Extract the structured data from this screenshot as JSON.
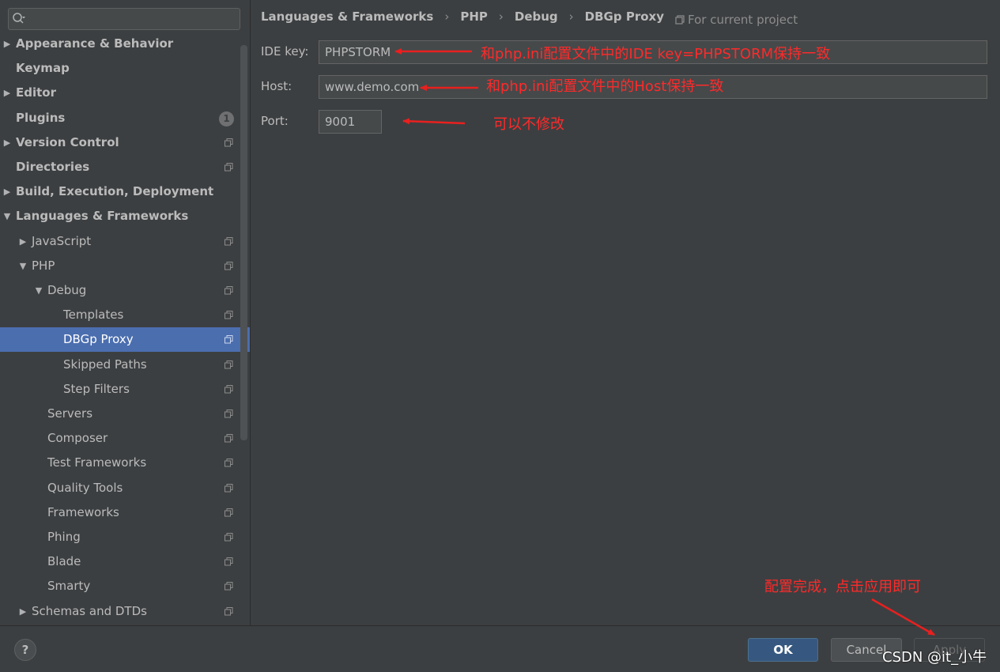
{
  "sidebar": {
    "search": {
      "placeholder": "",
      "value": ""
    },
    "items": [
      {
        "label": "Appearance & Behavior",
        "level": 0,
        "expander": "collapsed",
        "bold": true,
        "selected": false,
        "project": false,
        "badge": ""
      },
      {
        "label": "Keymap",
        "level": 0,
        "expander": "none",
        "bold": true,
        "selected": false,
        "project": false,
        "badge": ""
      },
      {
        "label": "Editor",
        "level": 0,
        "expander": "collapsed",
        "bold": true,
        "selected": false,
        "project": false,
        "badge": ""
      },
      {
        "label": "Plugins",
        "level": 0,
        "expander": "none",
        "bold": true,
        "selected": false,
        "project": false,
        "badge": "1"
      },
      {
        "label": "Version Control",
        "level": 0,
        "expander": "collapsed",
        "bold": true,
        "selected": false,
        "project": true,
        "badge": ""
      },
      {
        "label": "Directories",
        "level": 0,
        "expander": "none",
        "bold": true,
        "selected": false,
        "project": true,
        "badge": ""
      },
      {
        "label": "Build, Execution, Deployment",
        "level": 0,
        "expander": "collapsed",
        "bold": true,
        "selected": false,
        "project": false,
        "badge": ""
      },
      {
        "label": "Languages & Frameworks",
        "level": 0,
        "expander": "expanded",
        "bold": true,
        "selected": false,
        "project": false,
        "badge": ""
      },
      {
        "label": "JavaScript",
        "level": 1,
        "expander": "collapsed",
        "bold": false,
        "selected": false,
        "project": true,
        "badge": ""
      },
      {
        "label": "PHP",
        "level": 1,
        "expander": "expanded",
        "bold": false,
        "selected": false,
        "project": true,
        "badge": ""
      },
      {
        "label": "Debug",
        "level": 2,
        "expander": "expanded",
        "bold": false,
        "selected": false,
        "project": true,
        "badge": ""
      },
      {
        "label": "Templates",
        "level": 3,
        "expander": "none",
        "bold": false,
        "selected": false,
        "project": true,
        "badge": ""
      },
      {
        "label": "DBGp Proxy",
        "level": 3,
        "expander": "none",
        "bold": false,
        "selected": true,
        "project": true,
        "badge": ""
      },
      {
        "label": "Skipped Paths",
        "level": 3,
        "expander": "none",
        "bold": false,
        "selected": false,
        "project": true,
        "badge": ""
      },
      {
        "label": "Step Filters",
        "level": 3,
        "expander": "none",
        "bold": false,
        "selected": false,
        "project": true,
        "badge": ""
      },
      {
        "label": "Servers",
        "level": 2,
        "expander": "none",
        "bold": false,
        "selected": false,
        "project": true,
        "badge": ""
      },
      {
        "label": "Composer",
        "level": 2,
        "expander": "none",
        "bold": false,
        "selected": false,
        "project": true,
        "badge": ""
      },
      {
        "label": "Test Frameworks",
        "level": 2,
        "expander": "none",
        "bold": false,
        "selected": false,
        "project": true,
        "badge": ""
      },
      {
        "label": "Quality Tools",
        "level": 2,
        "expander": "none",
        "bold": false,
        "selected": false,
        "project": true,
        "badge": ""
      },
      {
        "label": "Frameworks",
        "level": 2,
        "expander": "none",
        "bold": false,
        "selected": false,
        "project": true,
        "badge": ""
      },
      {
        "label": "Phing",
        "level": 2,
        "expander": "none",
        "bold": false,
        "selected": false,
        "project": true,
        "badge": ""
      },
      {
        "label": "Blade",
        "level": 2,
        "expander": "none",
        "bold": false,
        "selected": false,
        "project": true,
        "badge": ""
      },
      {
        "label": "Smarty",
        "level": 2,
        "expander": "none",
        "bold": false,
        "selected": false,
        "project": true,
        "badge": ""
      },
      {
        "label": "Schemas and DTDs",
        "level": 1,
        "expander": "collapsed",
        "bold": false,
        "selected": false,
        "project": true,
        "badge": ""
      }
    ]
  },
  "breadcrumb": [
    "Languages & Frameworks",
    "PHP",
    "Debug",
    "DBGp Proxy"
  ],
  "scope_label": "For current project",
  "form": {
    "ide_key": {
      "label": "IDE key:",
      "value": "PHPSTORM"
    },
    "host": {
      "label": "Host:",
      "value": "www.demo.com"
    },
    "port": {
      "label": "Port:",
      "value": "9001"
    }
  },
  "annotations": {
    "ide_key_note": "和php.ini配置文件中的IDE key=PHPSTORM保持一致",
    "host_note": "和php.ini配置文件中的Host保持一致",
    "port_note": "可以不修改",
    "apply_note": "配置完成，点击应用即可",
    "color": "#ff2a2a"
  },
  "footer": {
    "help_label": "?",
    "ok_label": "OK",
    "cancel_label": "Cancel",
    "apply_label": "Apply"
  },
  "watermark": "CSDN @it_小牛",
  "colors": {
    "background": "#3c3f41",
    "selection": "#4b6eaf",
    "ok_button": "#365880",
    "text": "#bbbbbb"
  }
}
